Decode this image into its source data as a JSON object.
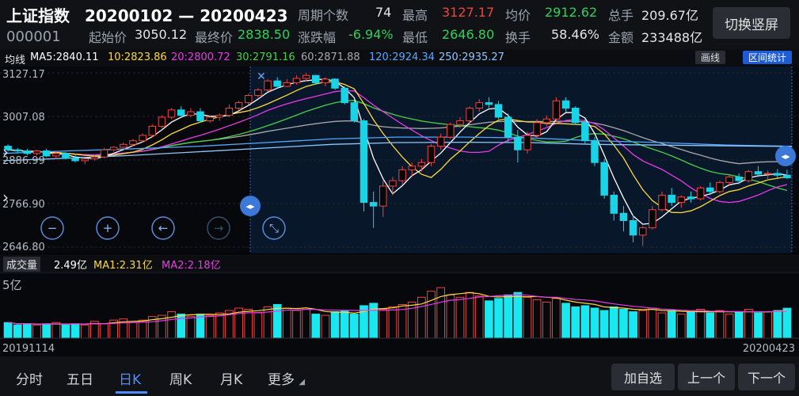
{
  "header": {
    "title": "上证指数",
    "date_range": "20200102 — 20200423",
    "code": "000001",
    "switch_button": "切换竖屏",
    "stats": {
      "period_label": "周期个数",
      "period_value": "74",
      "high_label": "最高",
      "high_value": "3127.17",
      "avg_label": "均价",
      "avg_value": "2912.62",
      "hands_label": "总手",
      "hands_value": "209.67亿",
      "start_label": "起始价",
      "start_value": "3050.12",
      "final_label": "最终价",
      "final_value": "2838.50",
      "change_label": "涨跌幅",
      "change_value": "-6.94%",
      "low_label": "最低",
      "low_value": "2646.80",
      "turnover_label": "换手",
      "turnover_value": "58.46%",
      "amount_label": "金额",
      "amount_value": "233488亿"
    }
  },
  "ma_bar": {
    "label": "均线",
    "ma5": "MA5:2840.11",
    "ma10": "10:2823.86",
    "ma20": "20:2800.72",
    "ma30": "30:2791.16",
    "ma60": "60:2871.88",
    "ma120": "120:2924.34",
    "ma250": "250:2935.27",
    "draw_button": "画线",
    "range_button": "区间统计",
    "colors": {
      "ma5": "#ffffff",
      "ma10": "#ffd93b",
      "ma20": "#e83ae8",
      "ma30": "#48d048",
      "ma60": "#aaaaaa",
      "ma120": "#55a8ff",
      "ma250": "#8ec8ff"
    }
  },
  "price_axis": {
    "top": "3127.17",
    "mid1": "3007.08",
    "mid2": "2886.99",
    "mid3": "2766.90",
    "bottom": "2646.80"
  },
  "zoom_controls": [
    "zoom-out-icon",
    "zoom-in-icon",
    "pan-left-icon",
    "pan-right-icon",
    "collapse-icon"
  ],
  "volume_bar": {
    "label": "成交量",
    "value": "2.49亿",
    "ma1": "MA1:2.31亿",
    "ma2": "MA2:2.18亿",
    "axis_label": "5亿"
  },
  "dates": {
    "start": "20191114",
    "end": "20200423"
  },
  "bottom_nav": {
    "tabs": [
      "分时",
      "五日",
      "日K",
      "周K",
      "月K",
      "更多"
    ],
    "active_tab": "日K",
    "add_button": "加自选",
    "prev_button": "上一个",
    "next_button": "下一个"
  },
  "chart_data": {
    "type": "candlestick",
    "y_range": [
      2646.8,
      3127.17
    ],
    "candles": [
      [
        2925,
        2930,
        2910,
        2915
      ],
      [
        2915,
        2920,
        2905,
        2912
      ],
      [
        2912,
        2918,
        2900,
        2905
      ],
      [
        2905,
        2915,
        2900,
        2912
      ],
      [
        2912,
        2918,
        2895,
        2898
      ],
      [
        2898,
        2910,
        2890,
        2905
      ],
      [
        2905,
        2908,
        2888,
        2892
      ],
      [
        2892,
        2900,
        2880,
        2885
      ],
      [
        2885,
        2892,
        2875,
        2890
      ],
      [
        2890,
        2900,
        2885,
        2895
      ],
      [
        2895,
        2920,
        2892,
        2915
      ],
      [
        2915,
        2925,
        2910,
        2922
      ],
      [
        2922,
        2935,
        2918,
        2930
      ],
      [
        2930,
        2945,
        2925,
        2940
      ],
      [
        2940,
        2960,
        2935,
        2955
      ],
      [
        2955,
        2985,
        2950,
        2980
      ],
      [
        2980,
        3010,
        2975,
        3005
      ],
      [
        3005,
        3030,
        3000,
        3025
      ],
      [
        3025,
        3035,
        3005,
        3010
      ],
      [
        3010,
        3030,
        3005,
        3020
      ],
      [
        3020,
        3030,
        2990,
        2995
      ],
      [
        2995,
        3010,
        2990,
        3005
      ],
      [
        3005,
        3015,
        2995,
        3010
      ],
      [
        3010,
        3040,
        3005,
        3030
      ],
      [
        3030,
        3050,
        3025,
        3045
      ],
      [
        3045,
        3070,
        3040,
        3065
      ],
      [
        3065,
        3085,
        3060,
        3080
      ],
      [
        3080,
        3110,
        3075,
        3105
      ],
      [
        3105,
        3115,
        3085,
        3090
      ],
      [
        3090,
        3110,
        3088,
        3100
      ],
      [
        3100,
        3120,
        3095,
        3112
      ],
      [
        3112,
        3127,
        3105,
        3120
      ],
      [
        3120,
        3122,
        3095,
        3100
      ],
      [
        3100,
        3115,
        3090,
        3110
      ],
      [
        3110,
        3112,
        3080,
        3085
      ],
      [
        3085,
        3090,
        3040,
        3045
      ],
      [
        3045,
        3050,
        2990,
        2995
      ],
      [
        2995,
        3000,
        2745,
        2770
      ],
      [
        2770,
        2800,
        2700,
        2760
      ],
      [
        2760,
        2830,
        2730,
        2815
      ],
      [
        2815,
        2840,
        2790,
        2830
      ],
      [
        2830,
        2870,
        2820,
        2860
      ],
      [
        2860,
        2880,
        2840,
        2870
      ],
      [
        2870,
        2890,
        2855,
        2880
      ],
      [
        2880,
        2930,
        2870,
        2925
      ],
      [
        2925,
        2960,
        2915,
        2950
      ],
      [
        2950,
        2990,
        2945,
        2985
      ],
      [
        2985,
        3005,
        2975,
        2995
      ],
      [
        2995,
        3035,
        2985,
        3030
      ],
      [
        3030,
        3055,
        3020,
        3045
      ],
      [
        3045,
        3060,
        3030,
        3040
      ],
      [
        3040,
        3050,
        3000,
        3005
      ],
      [
        3005,
        3015,
        2935,
        2950
      ],
      [
        2950,
        2970,
        2880,
        2915
      ],
      [
        2915,
        2965,
        2905,
        2955
      ],
      [
        2955,
        3000,
        2945,
        2990
      ],
      [
        2990,
        3010,
        2980,
        3000
      ],
      [
        3000,
        3060,
        2995,
        3050
      ],
      [
        3050,
        3060,
        3020,
        3030
      ],
      [
        3030,
        3035,
        2985,
        2990
      ],
      [
        2990,
        3000,
        2930,
        2940
      ],
      [
        2940,
        2950,
        2870,
        2880
      ],
      [
        2880,
        2890,
        2780,
        2790
      ],
      [
        2790,
        2800,
        2720,
        2740
      ],
      [
        2740,
        2760,
        2690,
        2720
      ],
      [
        2720,
        2735,
        2660,
        2680
      ],
      [
        2680,
        2705,
        2650,
        2700
      ],
      [
        2700,
        2760,
        2695,
        2750
      ],
      [
        2750,
        2800,
        2745,
        2790
      ],
      [
        2790,
        2810,
        2760,
        2770
      ],
      [
        2770,
        2790,
        2755,
        2785
      ],
      [
        2785,
        2800,
        2770,
        2780
      ],
      [
        2780,
        2815,
        2775,
        2810
      ],
      [
        2810,
        2825,
        2790,
        2800
      ],
      [
        2800,
        2830,
        2795,
        2825
      ],
      [
        2825,
        2845,
        2815,
        2840
      ],
      [
        2840,
        2850,
        2820,
        2830
      ],
      [
        2830,
        2860,
        2825,
        2855
      ],
      [
        2855,
        2870,
        2840,
        2848
      ],
      [
        2848,
        2858,
        2830,
        2850
      ],
      [
        2850,
        2862,
        2838,
        2845
      ],
      [
        2845,
        2860,
        2835,
        2838
      ]
    ],
    "volumes": [
      1.3,
      1.1,
      1.2,
      1.1,
      1.2,
      1.3,
      1.1,
      1.2,
      1.1,
      1.4,
      1.2,
      1.5,
      1.6,
      1.3,
      1.5,
      1.8,
      1.9,
      2.2,
      2.0,
      1.8,
      2.0,
      1.9,
      2.1,
      2.3,
      2.5,
      2.4,
      2.1,
      2.6,
      2.8,
      2.5,
      2.3,
      2.4,
      2.0,
      1.9,
      2.2,
      2.3,
      2.0,
      2.7,
      2.9,
      2.4,
      2.6,
      2.8,
      3.0,
      3.4,
      3.9,
      4.2,
      3.6,
      3.4,
      3.8,
      3.5,
      3.1,
      3.3,
      3.6,
      3.8,
      3.4,
      3.2,
      3.0,
      3.3,
      2.9,
      2.6,
      2.7,
      2.5,
      2.3,
      2.6,
      2.4,
      2.2,
      2.3,
      2.5,
      2.1,
      2.3,
      2.0,
      2.2,
      2.4,
      2.1,
      2.3,
      2.0,
      2.2,
      2.4,
      2.1,
      2.2,
      2.3,
      2.49
    ]
  }
}
